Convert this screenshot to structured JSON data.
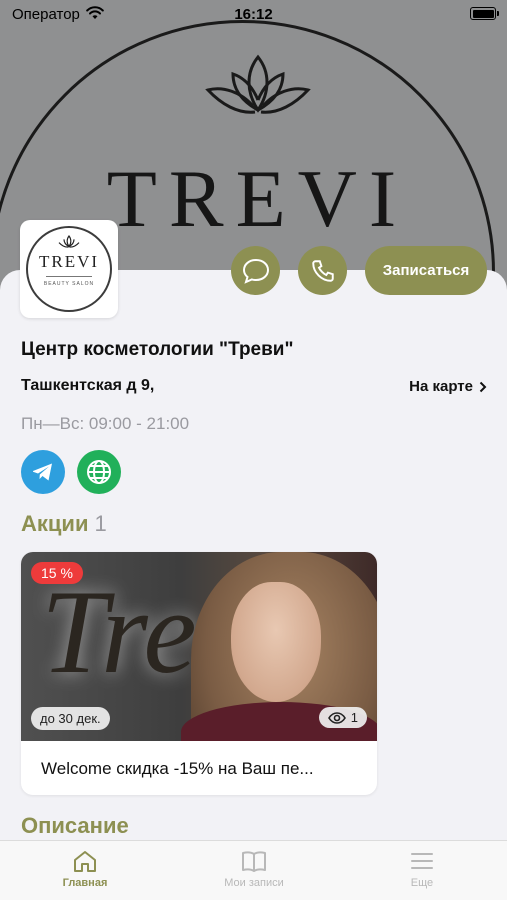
{
  "status_bar": {
    "carrier": "Оператор",
    "time": "16:12",
    "battery_level": 1.0
  },
  "hero": {
    "brand": "TREVI"
  },
  "logo": {
    "brand": "TREVI",
    "subtitle": "BEAUTY SALON"
  },
  "actions": {
    "book_label": "Записаться"
  },
  "salon": {
    "title": "Центр косметологии \"Треви\"",
    "address": "Ташкентская д 9,",
    "map_link": "На карте",
    "hours": "Пн—Вс: 09:00 - 21:00"
  },
  "promotions": {
    "heading": "Акции",
    "count": "1",
    "card": {
      "discount": "15 %",
      "date": "до 30 дек.",
      "views": "1",
      "image_script": "Tre",
      "text": "Welcome скидка -15% на Ваш пе..."
    }
  },
  "description": {
    "heading": "Описание"
  },
  "tabs": [
    {
      "label": "Главная",
      "active": true
    },
    {
      "label": "Мои записи",
      "active": false
    },
    {
      "label": "Еще",
      "active": false
    }
  ],
  "colors": {
    "accent": "#8d9052",
    "telegram": "#2e9fde",
    "web": "#21b05a",
    "discount": "#ee3b3b"
  }
}
